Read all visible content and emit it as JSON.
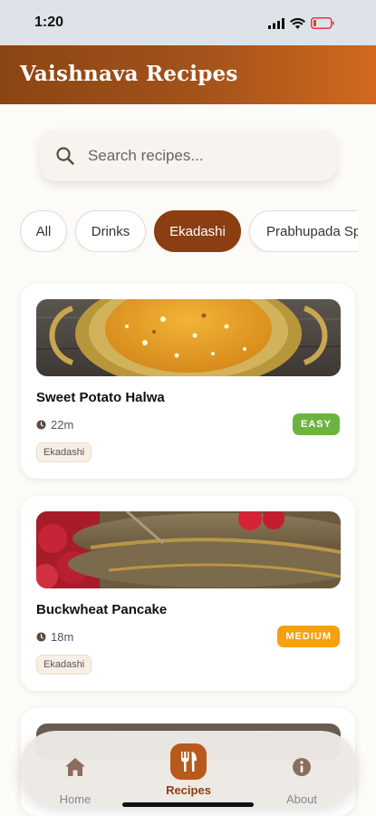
{
  "status_bar": {
    "time": "1:20"
  },
  "header": {
    "title": "Vaishnava Recipes"
  },
  "search": {
    "placeholder": "Search recipes..."
  },
  "filters": {
    "chips": [
      {
        "label": "All",
        "active": false
      },
      {
        "label": "Drinks",
        "active": false
      },
      {
        "label": "Ekadashi",
        "active": true
      },
      {
        "label": "Prabhupada Sp",
        "active": false
      }
    ]
  },
  "recipes": [
    {
      "title": "Sweet Potato Halwa",
      "time": "22m",
      "difficulty": "EASY",
      "difficulty_color": "#6db33f",
      "tag": "Ekadashi"
    },
    {
      "title": "Buckwheat Pancake",
      "time": "18m",
      "difficulty": "MEDIUM",
      "difficulty_color": "#f5a00f",
      "tag": "Ekadashi"
    }
  ],
  "tabbar": {
    "tabs": [
      {
        "label": "Home",
        "icon": "home-icon",
        "active": false
      },
      {
        "label": "Recipes",
        "icon": "utensils-icon",
        "active": true
      },
      {
        "label": "About",
        "icon": "info-icon",
        "active": false
      }
    ]
  },
  "colors": {
    "brand": "#8b4513",
    "accent": "#d2691e",
    "active_chip": "#8b3e12"
  }
}
